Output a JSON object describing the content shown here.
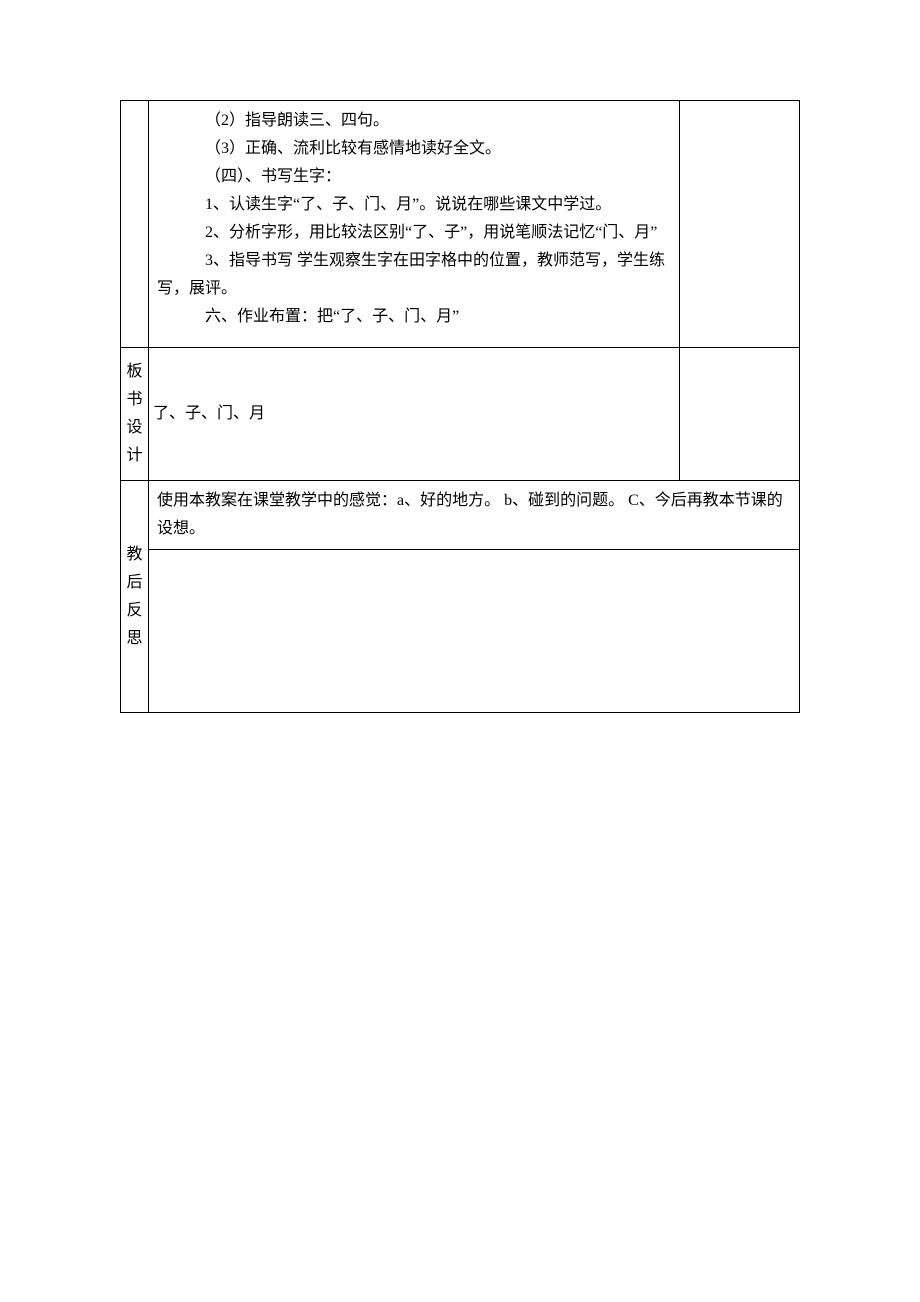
{
  "row1": {
    "lines": [
      "（2）指导朗读三、四句。",
      "（3）正确、流利比较有感情地读好全文。",
      "（四）、书写生字：",
      "1、认读生字“了、子、门、月”。说说在哪些课文中学过。",
      "2、分析字形，用比较法区别“了、子”，用说笔顺法记忆“门、月”",
      "3、指导书写 学生观察生字在田字格中的位置，教师范写，学生练写，展评。",
      "六、作业布置：把“了、子、门、月”"
    ]
  },
  "row2": {
    "labelChars": [
      "板",
      "书",
      "设",
      "计"
    ],
    "content": "了、子、门、月"
  },
  "row3": {
    "labelChars": [
      "教",
      "后",
      "反",
      "思"
    ],
    "note": "使用本教案在课堂教学中的感觉：a、好的地方。  b、碰到的问题。  C、今后再教本节课的设想。"
  }
}
